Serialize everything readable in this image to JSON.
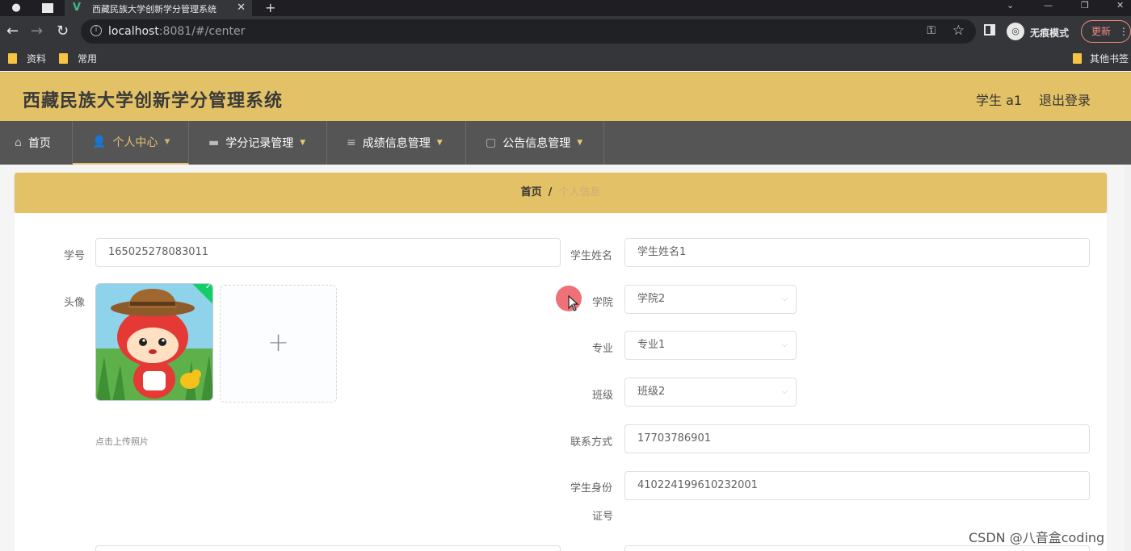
{
  "browser": {
    "tab_title": "西藏民族大学创新学分管理系统",
    "url_host": "localhost",
    "url_rest": ":8081/#/center",
    "incognito_label": "无痕模式",
    "update_label": "更新",
    "bookmarks": [
      "资料",
      "常用"
    ],
    "other_bookmarks": "其他书签"
  },
  "app": {
    "title": "西藏民族大学创新学分管理系统",
    "user": "学生 a1",
    "logout": "退出登录"
  },
  "menu": [
    {
      "label": "首页",
      "icon": "home-icon"
    },
    {
      "label": "个人中心",
      "icon": "user-icon"
    },
    {
      "label": "学分记录管理",
      "icon": "briefcase-icon"
    },
    {
      "label": "成绩信息管理",
      "icon": "list-icon"
    },
    {
      "label": "公告信息管理",
      "icon": "chat-icon"
    }
  ],
  "breadcrumb": {
    "home": "首页",
    "separator": "/",
    "current": "个人信息"
  },
  "form": {
    "student_id": {
      "label": "学号",
      "value": "165025278083011"
    },
    "student_name": {
      "label": "学生姓名",
      "value": "学生姓名1"
    },
    "avatar": {
      "label": "头像",
      "tip": "点击上传照片"
    },
    "college": {
      "label": "学院",
      "value": "学院2"
    },
    "major": {
      "label": "专业",
      "value": "专业1"
    },
    "class": {
      "label": "班级",
      "value": "班级2"
    },
    "phone": {
      "label": "联系方式",
      "value": "17703786901"
    },
    "id_card": {
      "label_line1": "学生身份",
      "label_line2": "证号",
      "value": "410224199610232001"
    }
  },
  "watermark": "CSDN @八音盒coding",
  "colors": {
    "header_bg": "#e3c166",
    "menu_bg": "#555555",
    "active_menu": "#e6c36d"
  }
}
